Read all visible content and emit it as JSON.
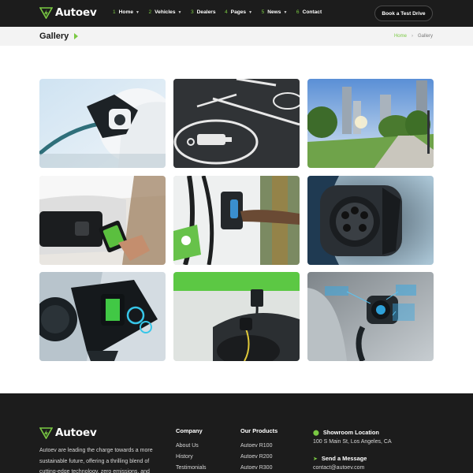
{
  "header": {
    "logo": "Autoev",
    "nav": [
      {
        "num": "1",
        "label": "Home",
        "caret": true
      },
      {
        "num": "2",
        "label": "Vehicles",
        "caret": true
      },
      {
        "num": "3",
        "label": "Dealers",
        "caret": false
      },
      {
        "num": "4",
        "label": "Pages",
        "caret": true
      },
      {
        "num": "5",
        "label": "News",
        "caret": true
      },
      {
        "num": "6",
        "label": "Contact",
        "caret": false
      }
    ],
    "cta": "Book a Test Drive"
  },
  "titlebar": {
    "title": "Gallery",
    "breadcrumb": {
      "home": "Home",
      "current": "Gallery"
    }
  },
  "gallery": {
    "images": [
      {
        "subject": "ev-charging-plug"
      },
      {
        "subject": "ev-parking-spot"
      },
      {
        "subject": "city-park"
      },
      {
        "subject": "phone-app-charging"
      },
      {
        "subject": "charging-station-hand"
      },
      {
        "subject": "charging-port-closeup"
      },
      {
        "subject": "futuristic-connector"
      },
      {
        "subject": "green-wall-charger"
      },
      {
        "subject": "holographic-charging"
      }
    ]
  },
  "footer": {
    "logo": "Autoev",
    "description": "Autoev are leading the charge towards a more sustainable future, offering a thrilling blend of cutting-edge technology, zero emissions, and",
    "company": {
      "title": "Company",
      "links": [
        "About Us",
        "History",
        "Testimonials"
      ]
    },
    "products": {
      "title": "Our Products",
      "links": [
        "Autoev R100",
        "Autoev R200",
        "Autoev R300"
      ]
    },
    "location": {
      "title": "Showroom Location",
      "value": "100 S Main St, Los Angeles, CA"
    },
    "message": {
      "title": "Send a Message",
      "value": "contact@autoev.com"
    }
  },
  "colors": {
    "accent": "#7ac943",
    "dark": "#1c1c1c",
    "light": "#f3f3f3"
  }
}
